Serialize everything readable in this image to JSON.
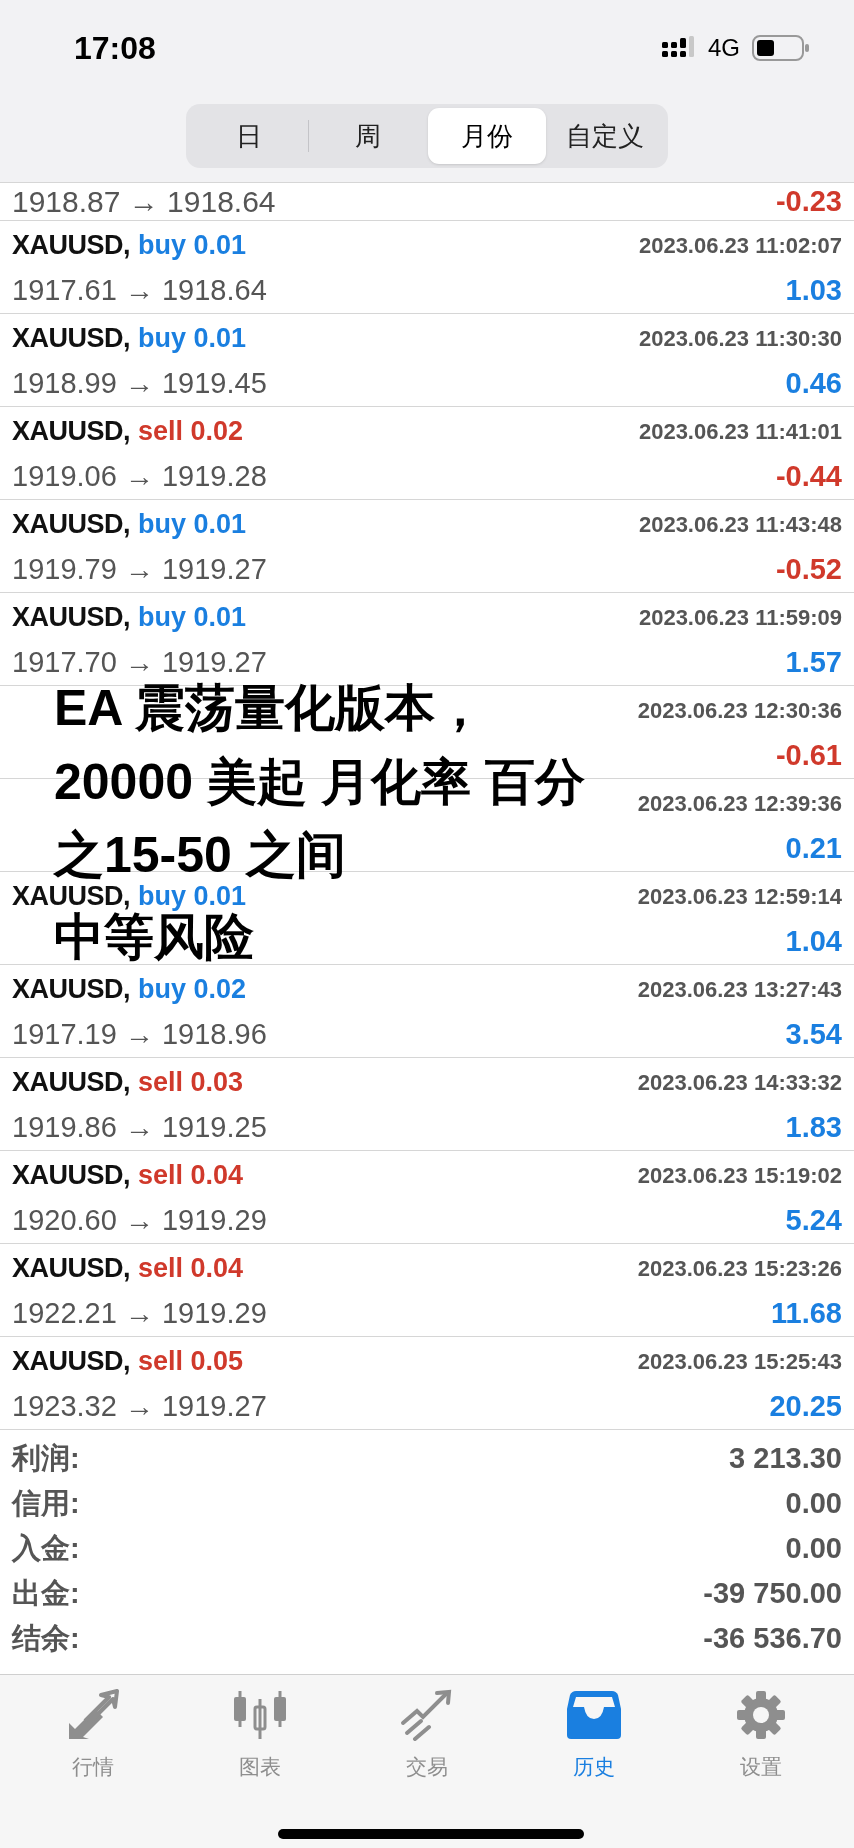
{
  "status_bar": {
    "time": "17:08",
    "network": "4G"
  },
  "period_tabs": [
    {
      "label": "日",
      "selected": false
    },
    {
      "label": "周",
      "selected": false
    },
    {
      "label": "月份",
      "selected": true
    },
    {
      "label": "自定义",
      "selected": false
    }
  ],
  "first_row": {
    "prices": "1918.87 → 1918.64",
    "profit": "-0.23",
    "negative": true
  },
  "trades": [
    {
      "symbol": "XAUUSD,",
      "side": "buy",
      "lots": "0.01",
      "time": "2023.06.23 11:02:07",
      "prices": "1917.61 → 1918.64",
      "profit": "1.03",
      "negative": false
    },
    {
      "symbol": "XAUUSD,",
      "side": "buy",
      "lots": "0.01",
      "time": "2023.06.23 11:30:30",
      "prices": "1918.99 → 1919.45",
      "profit": "0.46",
      "negative": false
    },
    {
      "symbol": "XAUUSD,",
      "side": "sell",
      "lots": "0.02",
      "time": "2023.06.23 11:41:01",
      "prices": "1919.06 → 1919.28",
      "profit": "-0.44",
      "negative": true
    },
    {
      "symbol": "XAUUSD,",
      "side": "buy",
      "lots": "0.01",
      "time": "2023.06.23 11:43:48",
      "prices": "1919.79 → 1919.27",
      "profit": "-0.52",
      "negative": true
    },
    {
      "symbol": "XAUUSD,",
      "side": "buy",
      "lots": "0.01",
      "time": "2023.06.23 11:59:09",
      "prices": "1917.70 → 1919.27",
      "profit": "1.57",
      "negative": false
    },
    {
      "time": "2023.06.23 12:30:36",
      "profit": "-0.61",
      "negative": true
    },
    {
      "time": "2023.06.23 12:39:36",
      "profit": "0.21",
      "negative": false
    },
    {
      "symbol": "XAUUSD,",
      "side": "buy",
      "lots": "0.01",
      "time": "2023.06.23 12:59:14",
      "profit": "1.04",
      "negative": false
    },
    {
      "symbol": "XAUUSD,",
      "side": "buy",
      "lots": "0.02",
      "time": "2023.06.23 13:27:43",
      "prices": "1917.19 → 1918.96",
      "profit": "3.54",
      "negative": false
    },
    {
      "symbol": "XAUUSD,",
      "side": "sell",
      "lots": "0.03",
      "time": "2023.06.23 14:33:32",
      "prices": "1919.86 → 1919.25",
      "profit": "1.83",
      "negative": false
    },
    {
      "symbol": "XAUUSD,",
      "side": "sell",
      "lots": "0.04",
      "time": "2023.06.23 15:19:02",
      "prices": "1920.60 → 1919.29",
      "profit": "5.24",
      "negative": false
    },
    {
      "symbol": "XAUUSD,",
      "side": "sell",
      "lots": "0.04",
      "time": "2023.06.23 15:23:26",
      "prices": "1922.21 → 1919.29",
      "profit": "11.68",
      "negative": false
    },
    {
      "symbol": "XAUUSD,",
      "side": "sell",
      "lots": "0.05",
      "time": "2023.06.23 15:25:43",
      "prices": "1923.32 → 1919.27",
      "profit": "20.25",
      "negative": false
    }
  ],
  "summary": [
    {
      "label": "利润:",
      "value": "3 213.30"
    },
    {
      "label": "信用:",
      "value": "0.00"
    },
    {
      "label": "入金:",
      "value": "0.00"
    },
    {
      "label": "出金:",
      "value": "-39 750.00"
    },
    {
      "label": "结余:",
      "value": "-36 536.70"
    }
  ],
  "overlay_caption": [
    "EA 震荡量化版本，",
    "20000 美起 月化率 百分",
    "之15-50 之间",
    "中等风险"
  ],
  "bottom_tabs": [
    {
      "kind": "quotes",
      "label": "行情",
      "selected": false
    },
    {
      "kind": "chart",
      "label": "图表",
      "selected": false
    },
    {
      "kind": "trade",
      "label": "交易",
      "selected": false
    },
    {
      "kind": "history",
      "label": "历史",
      "selected": true
    },
    {
      "kind": "settings",
      "label": "设置",
      "selected": false
    }
  ]
}
